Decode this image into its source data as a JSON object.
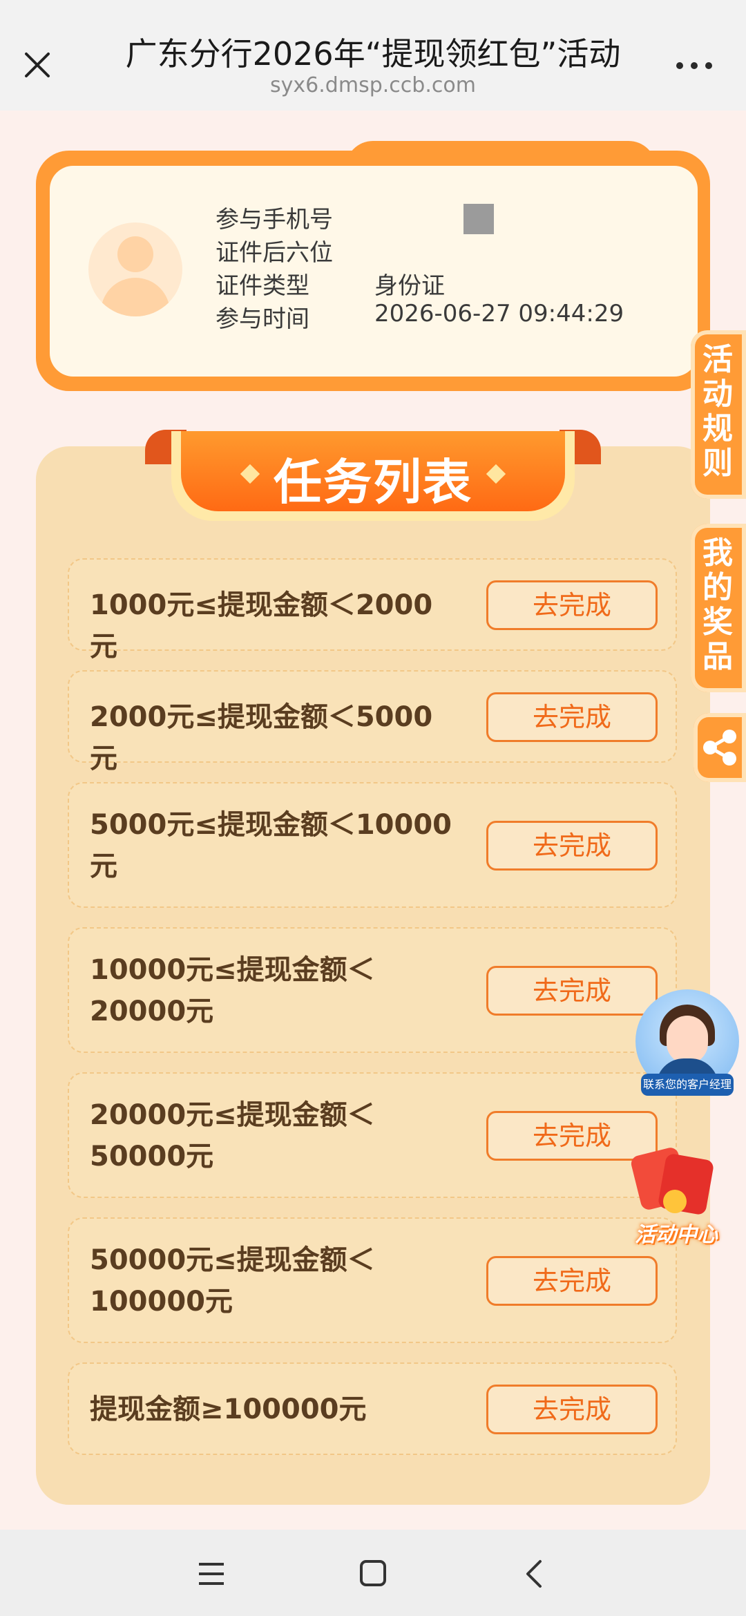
{
  "header": {
    "title": "广东分行2026年“提现领红包”活动",
    "url": "syx6.dmsp.ccb.com"
  },
  "user_card": {
    "fields": [
      {
        "label": "参与手机号",
        "value": ""
      },
      {
        "label": "证件后六位",
        "value": ""
      },
      {
        "label": "证件类型",
        "value": "身份证"
      },
      {
        "label": "参与时间",
        "value": "2026-06-27 09:44:29"
      }
    ]
  },
  "side_tabs": {
    "rules": "活动规则",
    "prizes": "我的奖品"
  },
  "task_list": {
    "title": "任务列表",
    "button_label": "去完成",
    "tasks": [
      "1000元≤提现金额＜2000元",
      "2000元≤提现金额＜5000元",
      "5000元≤提现金额＜10000元",
      "10000元≤提现金额＜20000元",
      "20000元≤提现金额＜50000元",
      "50000元≤提现金额＜100000元",
      "提现金额≥100000元"
    ]
  },
  "floating": {
    "agent_label": "联系您的客户经理",
    "activity_center": "活动中心"
  },
  "colors": {
    "accent": "#ff9b36",
    "button_text": "#f06a1a",
    "panel": "#f8deb2"
  },
  "icons": {
    "close": "close-icon",
    "more": "more-icon",
    "share": "share-icon",
    "nav_menu": "menu-icon",
    "nav_home": "home-icon",
    "nav_back": "back-icon"
  }
}
